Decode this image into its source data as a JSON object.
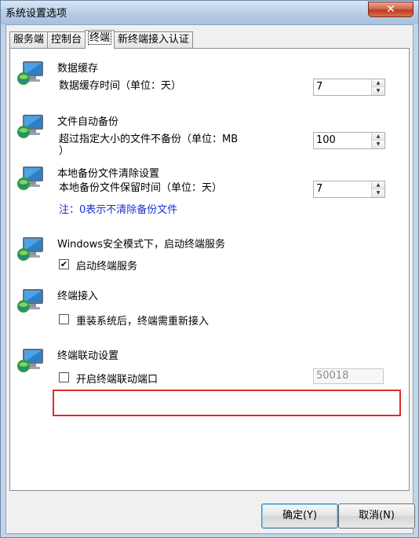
{
  "window": {
    "title": "系统设置选项",
    "close_label": "✕"
  },
  "tabs": [
    {
      "label": "服务端"
    },
    {
      "label": "控制台"
    },
    {
      "label": "终端"
    },
    {
      "label": "新终端接入认证"
    }
  ],
  "sections": {
    "data_cache": {
      "title": "数据缓存",
      "field_label": "数据缓存时间（单位：天）",
      "value": "7"
    },
    "auto_backup": {
      "title": "文件自动备份",
      "field_label_line1": "超过指定大小的文件不备份（单位：MB",
      "field_label_line2": "）",
      "value": "100"
    },
    "backup_cleanup": {
      "title": "本地备份文件清除设置",
      "field_label": "本地备份文件保留时间（单位：天）",
      "value": "7",
      "note": "注：0表示不清除备份文件"
    },
    "safe_mode": {
      "title": "Windows安全模式下，启动终端服务",
      "checkbox_label": "启动终端服务",
      "checked": true
    },
    "terminal_access": {
      "title": "终端接入",
      "checkbox_label": "重装系统后，终端需重新接入",
      "checked": false
    },
    "terminal_link": {
      "title": "终端联动设置",
      "checkbox_label": "开启终端联动端口",
      "checked": false,
      "port_value": "50018"
    }
  },
  "buttons": {
    "ok": "确定(Y)",
    "cancel": "取消(N)"
  },
  "icons": {
    "section_icon": "computer-globe-icon",
    "checkmark": "✔",
    "spin_up": "▲",
    "spin_down": "▼"
  },
  "colors": {
    "note": "#1a2fcf",
    "highlight": "#e02a2a"
  }
}
